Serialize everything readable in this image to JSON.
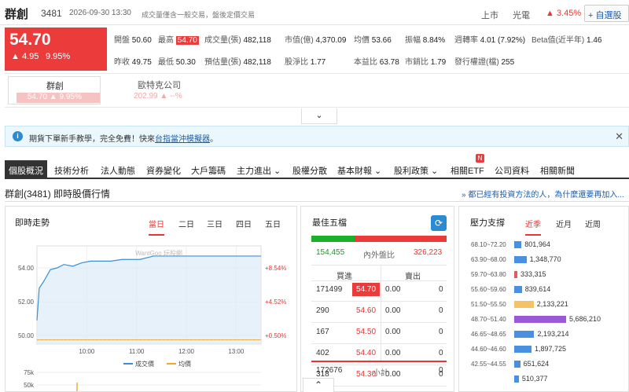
{
  "header": {
    "name": "群創",
    "code": "3481",
    "time": "2026-09-30 13:30",
    "note": "成交量僅含一般交易，盤後定價交易",
    "market": "上市",
    "sector": "光電",
    "change_pct": "▲ 3.45%",
    "watchlist": "+ 自選股"
  },
  "price": {
    "last": "54.70",
    "change": "▲ 4.95",
    "change_pct": "9.95%"
  },
  "stats": {
    "open_l": "開盤",
    "open": "50.60",
    "high_l": "最高",
    "high": "54.70",
    "vol_l": "成交量(張)",
    "vol": "482,118",
    "mcap_l": "市值(億)",
    "mcap": "4,370.09",
    "avg_l": "均價",
    "avg": "53.66",
    "amp_l": "振幅",
    "amp": "8.84%",
    "turn_l": "週轉率",
    "turn": "4.01 (7.92%)",
    "beta_l": "Beta值(近半年)",
    "beta": "1.46",
    "prev_l": "昨收",
    "prev": "49.75",
    "low_l": "最低",
    "low": "50.30",
    "est_l": "預估量(張)",
    "est": "482,118",
    "pb_l": "股淨比",
    "pb": "1.77",
    "pe_l": "本益比",
    "pe": "63.78",
    "ps_l": "市銷比",
    "ps": "1.79",
    "shares_l": "發行權證(檔)",
    "shares": "255"
  },
  "compare": [
    {
      "name": "群創",
      "value": "54.70 ▲ 9.95%"
    },
    {
      "name": "歐特克公司",
      "value": "202.99 ▲ --%"
    }
  ],
  "toggle_icon": "chevron-down",
  "notice": {
    "text_a": "期貨下單新手教學，完全免費！快來",
    "link": "台指當沖模擬器",
    "text_b": "。",
    "close": "✕"
  },
  "tabs": [
    "個股概況",
    "技術分析",
    "法人動態",
    "資券變化",
    "大戶籌碼",
    "主力進出 ⌄",
    "股權分散",
    "基本財報 ⌄",
    "股利政策 ⌄",
    "相關ETF",
    "公司資料",
    "相關新聞"
  ],
  "tab_badge": "N",
  "section_title": "群創(3481) 即時股價行情",
  "section_link": "» 都已經有投資方法的人，為什麼還要再加入...",
  "intraday": {
    "title": "即時走勢",
    "tabs": [
      "當日",
      "二日",
      "三日",
      "四日",
      "五日"
    ],
    "watermark": "WantGoo 玩股網",
    "legend_price": "成交價",
    "legend_avg": "均價",
    "vol_labels": [
      "75k",
      "50k"
    ]
  },
  "chart_data": {
    "type": "line",
    "x_ticks": [
      "10:00",
      "11:00",
      "12:00",
      "13:00"
    ],
    "y_ticks": [
      50.0,
      52.0,
      54.0
    ],
    "y_right": [
      "+0.50%",
      "+4.52%",
      "+8.54%"
    ],
    "ylim": [
      49.5,
      55.3
    ],
    "series": [
      {
        "name": "成交價",
        "x": [
          0,
          0.01,
          0.03,
          0.06,
          0.09,
          0.12,
          0.16,
          0.2,
          0.24,
          0.28,
          0.33,
          0.38,
          0.42,
          0.46,
          0.52,
          0.6,
          0.7,
          0.8,
          0.9,
          1.0
        ],
        "values": [
          50.9,
          52.8,
          53.2,
          53.9,
          54.0,
          54.2,
          54.1,
          54.3,
          54.4,
          54.4,
          54.4,
          54.5,
          54.5,
          54.5,
          54.7,
          54.7,
          54.7,
          54.7,
          54.7,
          54.7
        ]
      },
      {
        "name": "均價",
        "x": [
          0,
          1.0
        ],
        "values": [
          49.75,
          49.75
        ]
      }
    ],
    "ref": 49.75
  },
  "orderbook": {
    "title": "最佳五檔",
    "inner_l": "內外盤比",
    "buy_vol": "154,455",
    "sell_vol": "326,223",
    "buy_ratio": 0.32,
    "head_buy": "買進",
    "head_sell": "賣出",
    "rows": [
      [
        "171499",
        "54.70",
        "0.00",
        "0"
      ],
      [
        "290",
        "54.60",
        "0.00",
        "0"
      ],
      [
        "167",
        "54.50",
        "0.00",
        "0"
      ],
      [
        "402",
        "54.40",
        "0.00",
        "0"
      ],
      [
        "318",
        "54.30",
        "0.00",
        "0"
      ]
    ],
    "total_l": "小計",
    "total_buy": "172676",
    "total_sell": "0",
    "refresh": "⟳"
  },
  "pressure": {
    "title": "壓力支撐",
    "tabs": [
      "近季",
      "近月",
      "近周"
    ],
    "rows": [
      {
        "range": "68.10~72.20",
        "val": "801,964",
        "v": 801964,
        "c": "#4a90e2"
      },
      {
        "range": "63.90~68.00",
        "val": "1,348,770",
        "v": 1348770,
        "c": "#4a90e2"
      },
      {
        "range": "59.70~63.80",
        "val": "333,315",
        "v": 333315,
        "c": "#e85a5a"
      },
      {
        "range": "55.60~59.60",
        "val": "839,614",
        "v": 839614,
        "c": "#4a90e2"
      },
      {
        "range": "51.50~55.50",
        "val": "2,133,221",
        "v": 2133221,
        "c": "#f5c266"
      },
      {
        "range": "48.70~51.40",
        "val": "5,686,210",
        "v": 5686210,
        "c": "#9b59d6"
      },
      {
        "range": "46.65~48.65",
        "val": "2,193,214",
        "v": 2193214,
        "c": "#4a90e2"
      },
      {
        "range": "44.60~46.60",
        "val": "1,897,725",
        "v": 1897725,
        "c": "#4a90e2"
      },
      {
        "range": "42.55~44.55",
        "val": "651,624",
        "v": 651624,
        "c": "#4a90e2"
      },
      {
        "range": "",
        "val": "510,377",
        "v": 510377,
        "c": "#4a90e2"
      }
    ]
  },
  "scroll_up": "⌃"
}
